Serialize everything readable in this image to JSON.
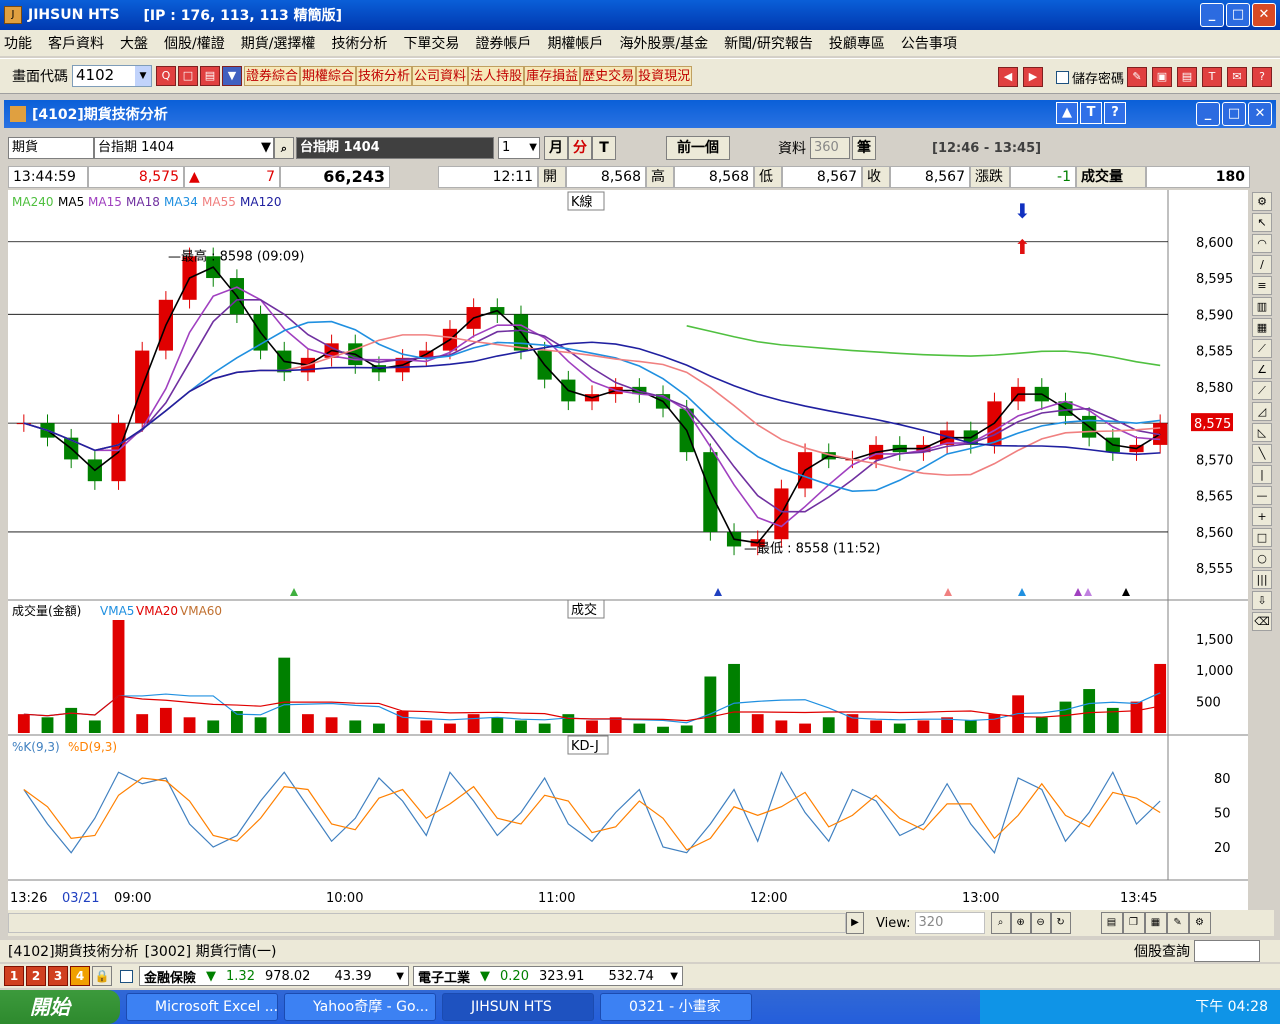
{
  "window": {
    "title": "JIHSUN HTS",
    "ip": "[IP : 176, 113, 113 精簡版]"
  },
  "menu": [
    "功能",
    "客戶資料",
    "大盤",
    "個股/權證",
    "期貨/選擇權",
    "技術分析",
    "下單交易",
    "證券帳戶",
    "期權帳戶",
    "海外股票/基金",
    "新聞/研究報告",
    "投顧專區",
    "公告事項"
  ],
  "toolbar": {
    "code_label": "畫面代碼",
    "code_value": "4102",
    "quick_links": [
      "證券綜合",
      "期權綜合",
      "技術分析",
      "公司資料",
      "法人持股",
      "庫存損益",
      "歷史交易",
      "投資現況"
    ],
    "save_password_label": "儲存密碼"
  },
  "inner": {
    "title": "[4102]期貨技術分析",
    "help_icons": [
      "▲",
      "T",
      "?"
    ]
  },
  "selector": {
    "market": "期貨",
    "contract": "台指期 1404",
    "contract_display": "台指期 1404",
    "period": "1",
    "month_btn": "月",
    "minute_btn": "分",
    "tick_btn": "T",
    "prev_btn": "前一個",
    "data_label": "資料",
    "data_count": "360",
    "unit": "筆",
    "time_range": "[12:46 - 13:45]"
  },
  "quote": {
    "time": "13:44:59",
    "price": "8,575",
    "change": "7",
    "volume_amt": "66,243",
    "bar_time": "12:11",
    "open_label": "開",
    "open": "8,568",
    "high_label": "高",
    "high": "8,568",
    "low_label": "低",
    "low": "8,567",
    "close_label": "收",
    "close": "8,567",
    "chg_label": "漲跌",
    "chg": "-1",
    "vol_label": "成交量",
    "vol": "180"
  },
  "colors": {
    "ma240": "#50c040",
    "ma5": "#000000",
    "ma15": "#a040c0",
    "ma18": "#7030a0",
    "ma34": "#2090e0",
    "ma55": "#f08080",
    "ma120": "#2020a0",
    "up": "#e00000",
    "down": "#008000",
    "k": "#4080c0",
    "d": "#ff8000"
  },
  "chart_data": [
    {
      "type": "candlestick",
      "title": "K線",
      "legend": [
        "MA240",
        "MA5",
        "MA15",
        "MA18",
        "MA34",
        "MA55",
        "MA120"
      ],
      "y_ticks": [
        "8,600",
        "8,595",
        "8,590",
        "8,585",
        "8,580",
        "8,575",
        "8,570",
        "8,565",
        "8,560",
        "8,555"
      ],
      "ylim": [
        8552,
        8603
      ],
      "current_price": "8,575",
      "high_note": "最高 : 8598 (09:09)",
      "low_note": "最低 : 8558 (11:52)",
      "x_ticks": [
        "13:26",
        "03/21",
        "09:00",
        "10:00",
        "11:00",
        "12:00",
        "13:00",
        "13:45"
      ],
      "close_series": [
        8575,
        8573,
        8570,
        8567,
        8575,
        8585,
        8592,
        8598,
        8595,
        8590,
        8585,
        8582,
        8584,
        8586,
        8583,
        8582,
        8584,
        8585,
        8588,
        8591,
        8590,
        8585,
        8581,
        8578,
        8579,
        8580,
        8579,
        8577,
        8571,
        8560,
        8558,
        8559,
        8566,
        8571,
        8570,
        8570,
        8572,
        8571,
        8572,
        8574,
        8572,
        8578,
        8580,
        8578,
        8576,
        8573,
        8571,
        8572,
        8575
      ]
    },
    {
      "type": "bar",
      "title": "成交",
      "legend": [
        "成交量(金額)",
        "VMA5",
        "VMA20",
        "VMA60"
      ],
      "y_ticks": [
        "1,500",
        "1,000",
        "500"
      ],
      "ylim": [
        0,
        1800
      ],
      "values": [
        300,
        250,
        400,
        200,
        1800,
        300,
        400,
        250,
        200,
        350,
        250,
        1200,
        300,
        250,
        200,
        150,
        350,
        200,
        150,
        300,
        250,
        200,
        150,
        300,
        200,
        250,
        150,
        100,
        120,
        900,
        1100,
        300,
        200,
        150,
        250,
        300,
        200,
        150,
        200,
        250,
        200,
        300,
        600,
        250,
        500,
        700,
        400,
        500,
        1100
      ]
    },
    {
      "type": "line",
      "title": "KD-J",
      "legend": [
        "%K(9,3)",
        "%D(9,3)"
      ],
      "y_ticks": [
        "80",
        "50",
        "20"
      ],
      "ylim": [
        0,
        100
      ],
      "k_values": [
        70,
        40,
        15,
        45,
        85,
        75,
        80,
        40,
        20,
        30,
        60,
        85,
        55,
        25,
        45,
        80,
        60,
        30,
        85,
        60,
        30,
        50,
        80,
        40,
        25,
        50,
        70,
        20,
        15,
        40,
        70,
        25,
        85,
        50,
        25,
        70,
        60,
        30,
        40,
        75,
        40,
        15,
        80,
        70,
        25,
        50,
        85,
        40,
        60
      ]
    }
  ],
  "chart_controls": {
    "view_label": "View:",
    "view_value": "320"
  },
  "tabs": [
    "[4102]期貨技術分析",
    "[3002] 期貨行情(一)"
  ],
  "stock_query_label": "個股查詢",
  "ticker": {
    "nums": [
      "1",
      "2",
      "3",
      "4"
    ],
    "item1_name": "金融保險",
    "item1_chg": "1.32",
    "item1_val": "978.02",
    "item1_vol": "43.39",
    "item2_name": "電子工業",
    "item2_chg": "0.20",
    "item2_val": "323.91",
    "item2_vol": "532.74"
  },
  "taskbar": {
    "start": "開始",
    "tasks": [
      "Microsoft Excel ...",
      "Yahoo奇摩 - Go...",
      "JIHSUN HTS",
      "0321 - 小畫家"
    ],
    "clock": "下午 04:28"
  }
}
